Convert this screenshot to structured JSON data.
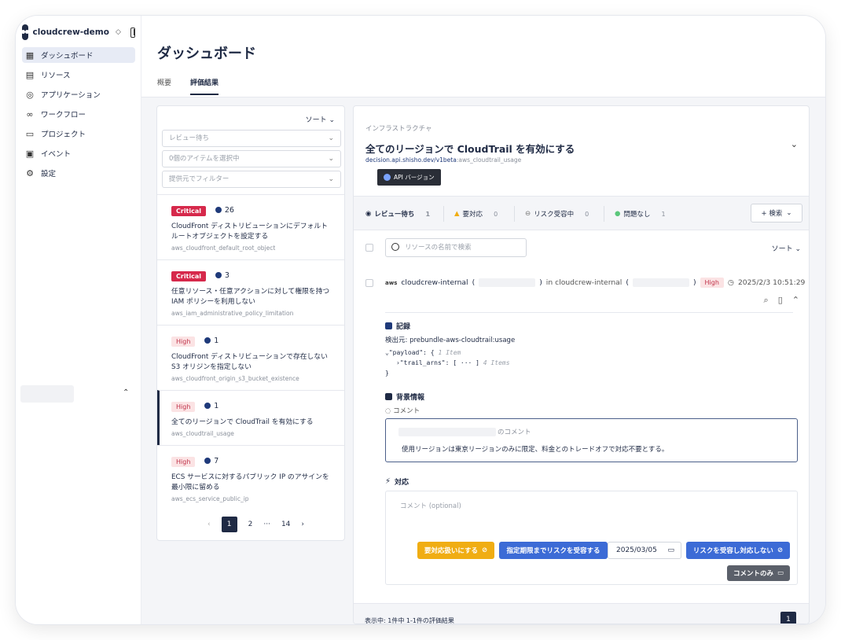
{
  "workspace": {
    "name": "cloudcrew-demo"
  },
  "nav": [
    {
      "label": "ダッシュボード",
      "icon": "dashboard-icon",
      "active": true
    },
    {
      "label": "リソース",
      "icon": "resource-icon"
    },
    {
      "label": "アプリケーション",
      "icon": "globe-icon"
    },
    {
      "label": "ワークフロー",
      "icon": "workflow-icon"
    },
    {
      "label": "プロジェクト",
      "icon": "folder-icon"
    },
    {
      "label": "イベント",
      "icon": "calendar-icon"
    },
    {
      "label": "設定",
      "icon": "gear-icon"
    }
  ],
  "header": {
    "title": "ダッシュボード",
    "tabs": [
      {
        "label": "概要"
      },
      {
        "label": "評価結果",
        "active": true
      }
    ]
  },
  "list": {
    "sort_label": "ソート",
    "filters": [
      {
        "placeholder": "レビュー待ち"
      },
      {
        "placeholder": "0個のアイテムを選択中"
      },
      {
        "placeholder": "提供元でフィルター"
      }
    ],
    "cards": [
      {
        "severity": "Critical",
        "count": "26",
        "title": "CloudFront ディストリビューションにデフォルトルートオブジェクトを設定する",
        "id": "aws_cloudfront_default_root_object"
      },
      {
        "severity": "Critical",
        "count": "3",
        "title": "任意リソース・任意アクションに対して権限を持つ IAM ポリシーを利用しない",
        "id": "aws_iam_administrative_policy_limitation"
      },
      {
        "severity": "High",
        "count": "1",
        "title": "CloudFront ディストリビューションで存在しない S3 オリジンを指定しない",
        "id": "aws_cloudfront_origin_s3_bucket_existence"
      },
      {
        "severity": "High",
        "count": "1",
        "title": "全てのリージョンで CloudTrail を有効にする",
        "id": "aws_cloudtrail_usage",
        "selected": true
      },
      {
        "severity": "High",
        "count": "7",
        "title": "ECS サービスに対するパブリック IP のアサインを最小限に留める",
        "id": "aws_ecs_service_public_ip"
      }
    ],
    "pager": {
      "prev": "‹",
      "p1": "1",
      "p2": "2",
      "ellipsis": "···",
      "last": "14",
      "next": "›"
    }
  },
  "detail": {
    "category": "インフラストラクチャ",
    "title": "全てのリージョンで CloudTrail を有効にする",
    "path_link": "decision.api.shisho.dev/v1beta",
    "path_rest": ":aws_cloudtrail_usage",
    "tooltip": "API バージョン",
    "statuses": [
      {
        "label": "レビュー待ち",
        "count": "1",
        "icon": "eye-slash-icon",
        "bold": true
      },
      {
        "label": "要対応",
        "count": "0",
        "icon": "warning-icon"
      },
      {
        "label": "リスク受容中",
        "count": "0",
        "icon": "minus-circle-icon"
      },
      {
        "label": "問題なし",
        "count": "1",
        "icon": "check-circle-icon"
      }
    ],
    "search_button": "+ 検索",
    "resource_search_placeholder": "リソースの名前で検索",
    "resource_sort": "ソート",
    "resource": {
      "provider": "aws",
      "name": "cloudcrew-internal",
      "in_text": "in cloudcrew-internal",
      "severity": "High",
      "timestamp": "2025/2/3 10:51:29"
    },
    "record": {
      "heading": "記録",
      "detected_by": "検出元: prebundle-aws-cloudtrail:usage",
      "code_line1": "⌄\"payload\": {",
      "code_line1_meta": "1 Item",
      "code_line2": "›\"trail_arns\": [ ··· ]",
      "code_line2_meta": "4 Items",
      "code_line3": "}"
    },
    "background": {
      "heading": "背景情報",
      "comment_label": "コメント",
      "comment_by_suffix": "のコメント",
      "comment_text": "使用リージョンは東京リージョンのみに限定、料金とのトレードオフで対応不要とする。"
    },
    "response": {
      "heading": "対応",
      "comment_placeholder": "コメント (optional)",
      "btn_action_required": "要対応扱いにする",
      "btn_accept_until": "指定期限までリスクを受容する",
      "date_value": "2025/03/05",
      "btn_accept_no_action": "リスクを受容し対応しない",
      "btn_comment_only": "コメントのみ"
    },
    "footer_text": "表示中: 1件中 1-1件の評価結果",
    "footer_page": "1"
  },
  "colors": {
    "accent": "#1f2a44",
    "critical": "#d6294b",
    "blue_button": "#3c6bd6",
    "yellow_button": "#f0ad13"
  }
}
